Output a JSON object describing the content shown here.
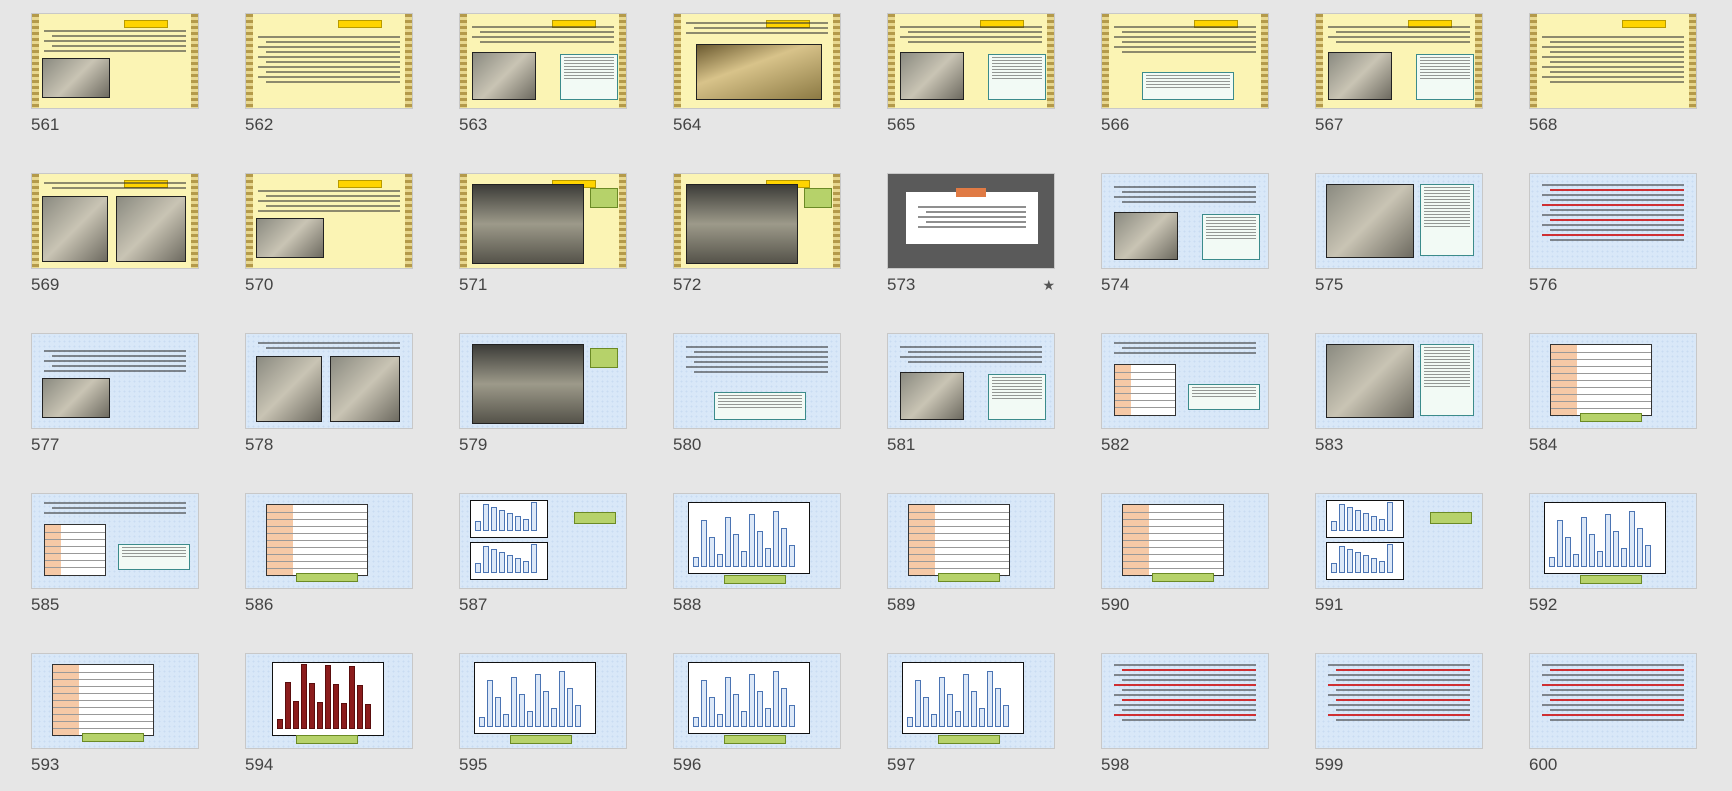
{
  "slides": [
    {
      "num": "561",
      "theme": "yellow",
      "layout": "text-photo"
    },
    {
      "num": "562",
      "theme": "yellow",
      "layout": "text"
    },
    {
      "num": "563",
      "theme": "yellow",
      "layout": "text-photo-box"
    },
    {
      "num": "564",
      "theme": "yellow",
      "layout": "wide-photo"
    },
    {
      "num": "565",
      "theme": "yellow",
      "layout": "text-photo-box"
    },
    {
      "num": "566",
      "theme": "yellow",
      "layout": "text-box"
    },
    {
      "num": "567",
      "theme": "yellow",
      "layout": "text-photo-box"
    },
    {
      "num": "568",
      "theme": "yellow",
      "layout": "text"
    },
    {
      "num": "569",
      "theme": "yellow",
      "layout": "two-photos"
    },
    {
      "num": "570",
      "theme": "yellow",
      "layout": "text-photo"
    },
    {
      "num": "571",
      "theme": "yellow",
      "layout": "big-photo"
    },
    {
      "num": "572",
      "theme": "yellow",
      "layout": "big-photo"
    },
    {
      "num": "573",
      "theme": "gray",
      "layout": "title",
      "starred": true
    },
    {
      "num": "574",
      "theme": "blue",
      "layout": "text-photo-box"
    },
    {
      "num": "575",
      "theme": "blue",
      "layout": "photo-box"
    },
    {
      "num": "576",
      "theme": "blue",
      "layout": "text-red"
    },
    {
      "num": "577",
      "theme": "blue",
      "layout": "text-photo"
    },
    {
      "num": "578",
      "theme": "blue",
      "layout": "two-photos"
    },
    {
      "num": "579",
      "theme": "blue",
      "layout": "big-photo"
    },
    {
      "num": "580",
      "theme": "blue",
      "layout": "text-box"
    },
    {
      "num": "581",
      "theme": "blue",
      "layout": "text-photo-box"
    },
    {
      "num": "582",
      "theme": "blue",
      "layout": "table-text"
    },
    {
      "num": "583",
      "theme": "blue",
      "layout": "photo-box"
    },
    {
      "num": "584",
      "theme": "blue",
      "layout": "table"
    },
    {
      "num": "585",
      "theme": "blue",
      "layout": "table-text"
    },
    {
      "num": "586",
      "theme": "blue",
      "layout": "table"
    },
    {
      "num": "587",
      "theme": "blue",
      "layout": "two-charts"
    },
    {
      "num": "588",
      "theme": "blue",
      "layout": "chart"
    },
    {
      "num": "589",
      "theme": "blue",
      "layout": "table"
    },
    {
      "num": "590",
      "theme": "blue",
      "layout": "table"
    },
    {
      "num": "591",
      "theme": "blue",
      "layout": "two-charts"
    },
    {
      "num": "592",
      "theme": "blue",
      "layout": "chart"
    },
    {
      "num": "593",
      "theme": "blue",
      "layout": "table"
    },
    {
      "num": "594",
      "theme": "blue",
      "layout": "chart-red"
    },
    {
      "num": "595",
      "theme": "blue",
      "layout": "chart"
    },
    {
      "num": "596",
      "theme": "blue",
      "layout": "chart"
    },
    {
      "num": "597",
      "theme": "blue",
      "layout": "chart"
    },
    {
      "num": "598",
      "theme": "blue",
      "layout": "text-red"
    },
    {
      "num": "599",
      "theme": "blue",
      "layout": "text-red"
    },
    {
      "num": "600",
      "theme": "blue",
      "layout": "text-red"
    }
  ],
  "star_symbol": "★"
}
